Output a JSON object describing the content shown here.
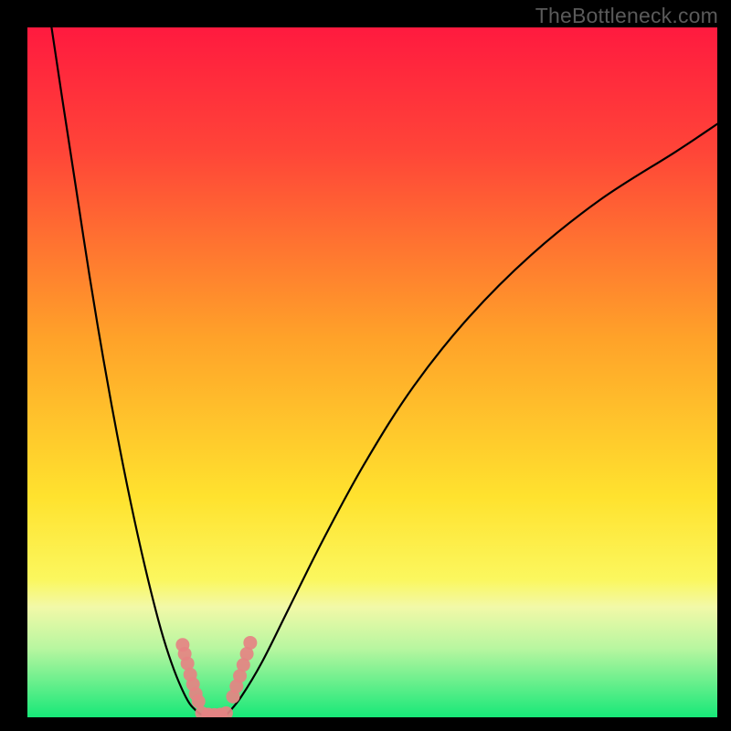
{
  "watermark": "TheBottleneck.com",
  "chart_data": {
    "type": "line",
    "title": "",
    "xlabel": "",
    "ylabel": "",
    "xlim": [
      0,
      100
    ],
    "ylim": [
      0,
      100
    ],
    "note": "No axis ticks or numeric labels are rendered in the image; values below are normalized 0–100 estimates read from pixel positions.",
    "gradient_stops": [
      {
        "pct": 0,
        "color": "#ff1a3f"
      },
      {
        "pct": 18,
        "color": "#ff4538"
      },
      {
        "pct": 45,
        "color": "#ffa229"
      },
      {
        "pct": 68,
        "color": "#ffe22e"
      },
      {
        "pct": 80,
        "color": "#fbf75e"
      },
      {
        "pct": 84,
        "color": "#f2f9a8"
      },
      {
        "pct": 90,
        "color": "#b8f6a0"
      },
      {
        "pct": 100,
        "color": "#17e878"
      }
    ],
    "series": [
      {
        "name": "left-branch",
        "color": "#000000",
        "x": [
          3.5,
          5,
          7,
          9,
          11,
          13,
          15,
          17,
          19,
          20.5,
          22,
          23.5,
          25
        ],
        "y": [
          100,
          90,
          77,
          64,
          52,
          41,
          31,
          22,
          14,
          9,
          5,
          2,
          0.5
        ]
      },
      {
        "name": "right-branch",
        "color": "#000000",
        "x": [
          29,
          31,
          34,
          38,
          43,
          49,
          56,
          64,
          73,
          83,
          94,
          100
        ],
        "y": [
          0.5,
          3,
          8,
          16,
          26,
          37,
          48,
          58,
          67,
          75,
          82,
          86
        ]
      },
      {
        "name": "valley-floor",
        "color": "#000000",
        "x": [
          25,
          26,
          27,
          28,
          29
        ],
        "y": [
          0.5,
          0.2,
          0.2,
          0.2,
          0.5
        ]
      }
    ],
    "markers": [
      {
        "name": "left-cluster",
        "color": "#e58383",
        "points_xy": [
          [
            22.5,
            10.5
          ],
          [
            22.8,
            9.2
          ],
          [
            23.2,
            7.8
          ],
          [
            23.6,
            6.2
          ],
          [
            24.0,
            4.8
          ],
          [
            24.4,
            3.4
          ],
          [
            24.8,
            2.3
          ]
        ]
      },
      {
        "name": "right-cluster",
        "color": "#e58383",
        "points_xy": [
          [
            29.8,
            3.0
          ],
          [
            30.3,
            4.5
          ],
          [
            30.8,
            6.0
          ],
          [
            31.3,
            7.6
          ],
          [
            31.8,
            9.2
          ],
          [
            32.3,
            10.8
          ]
        ]
      },
      {
        "name": "floor-cluster",
        "color": "#e58383",
        "points_xy": [
          [
            25.3,
            0.6
          ],
          [
            26.2,
            0.4
          ],
          [
            27.1,
            0.35
          ],
          [
            28.0,
            0.4
          ],
          [
            28.8,
            0.6
          ]
        ]
      }
    ]
  }
}
